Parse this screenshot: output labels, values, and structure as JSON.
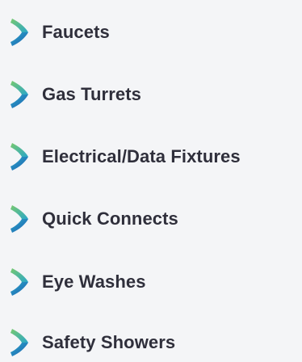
{
  "menu": {
    "items": [
      {
        "label": "Faucets",
        "icon": "chevron-ribbon-icon"
      },
      {
        "label": "Gas Turrets",
        "icon": "chevron-ribbon-icon"
      },
      {
        "label": "Electrical/Data Fixtures",
        "icon": "chevron-ribbon-icon"
      },
      {
        "label": "Quick Connects",
        "icon": "chevron-ribbon-icon"
      },
      {
        "label": "Eye Washes",
        "icon": "chevron-ribbon-icon"
      },
      {
        "label": "Safety Showers",
        "icon": "chevron-ribbon-icon"
      }
    ]
  },
  "colors": {
    "background": "#f4f5f7",
    "text": "#2f2f3b",
    "icon_green": "#5fbf8a",
    "icon_teal": "#2aa7c8",
    "icon_blue": "#1f6fb6"
  }
}
